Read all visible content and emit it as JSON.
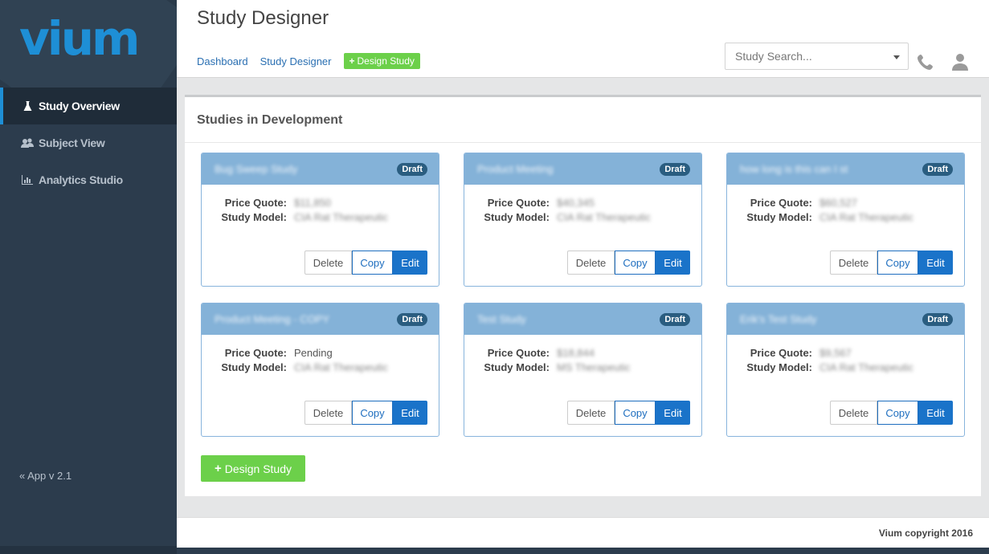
{
  "sidebar": {
    "logo": "vium",
    "items": [
      {
        "label": "Study Overview",
        "icon": "flask-icon",
        "active": true
      },
      {
        "label": "Subject View",
        "icon": "users-icon",
        "active": false
      },
      {
        "label": "Analytics Studio",
        "icon": "bar-chart-icon",
        "active": false
      }
    ],
    "version": "« App v 2.1"
  },
  "header": {
    "title": "Study Designer",
    "breadcrumbs": [
      "Dashboard",
      "Study Designer"
    ],
    "design_button": "Design Study",
    "search_placeholder": "Study Search..."
  },
  "panel": {
    "title": "Studies in Development",
    "labels": {
      "price": "Price Quote:",
      "model": "Study Model:"
    },
    "buttons": {
      "delete": "Delete",
      "copy": "Copy",
      "edit": "Edit"
    },
    "cards": [
      {
        "name": "Bug Sweep Study",
        "status": "Draft",
        "price": "$11,850",
        "model": "CIA Rat Therapeutic"
      },
      {
        "name": "Product Meeting",
        "status": "Draft",
        "price": "$40,345",
        "model": "CIA Rat Therapeutic"
      },
      {
        "name": "how long is this can I st",
        "status": "Draft",
        "price": "$60,527",
        "model": "CIA Rat Therapeutic"
      },
      {
        "name": "Product Meeting - COPY",
        "status": "Draft",
        "price": "Pending",
        "model": "CIA Rat Therapeutic"
      },
      {
        "name": "Test Study",
        "status": "Draft",
        "price": "$18,844",
        "model": "MS Therapeutic"
      },
      {
        "name": "Erik's Test Study",
        "status": "Draft",
        "price": "$9,567",
        "model": "CIA Rat Therapeutic"
      }
    ],
    "design_button": "Design Study"
  },
  "footer": {
    "copyright": "Vium copyright 2016"
  }
}
